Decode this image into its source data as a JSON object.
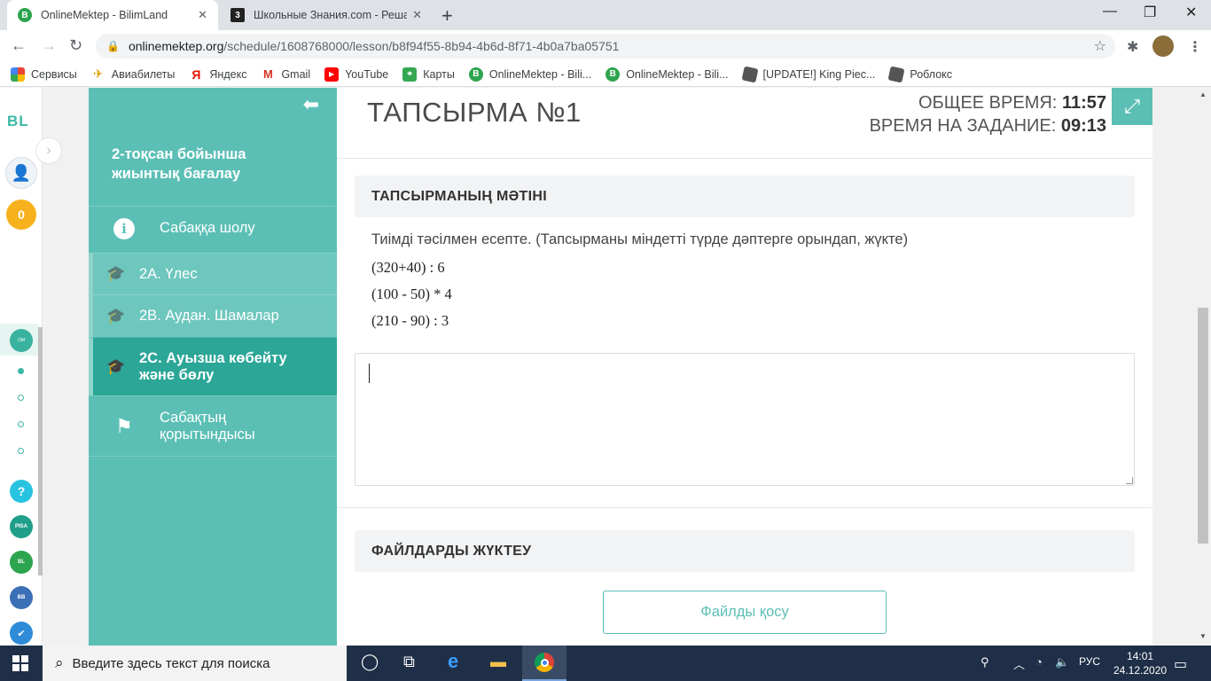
{
  "browser": {
    "tabs": [
      {
        "title": "OnlineMektep - BilimLand",
        "favicon": "onlinemektep-icon"
      },
      {
        "title": "Школьные Знания.com - Решае",
        "favicon": "znanija-icon"
      }
    ],
    "new_tab": "+",
    "url_host": "onlinemektep.org",
    "url_path": "/schedule/1608768000/lesson/b8f94f55-8b94-4b6d-8f71-4b0a7ba05751",
    "bookmarks": [
      {
        "label": "Сервисы",
        "icon": "apps-icon"
      },
      {
        "label": "Авиабилеты",
        "icon": "plane-icon"
      },
      {
        "label": "Яндекс",
        "icon": "yandex-icon"
      },
      {
        "label": "Gmail",
        "icon": "gmail-icon"
      },
      {
        "label": "YouTube",
        "icon": "youtube-icon"
      },
      {
        "label": "Карты",
        "icon": "maps-icon"
      },
      {
        "label": "OnlineMektep - Bili...",
        "icon": "onlinemektep-icon"
      },
      {
        "label": "OnlineMektep - Bili...",
        "icon": "onlinemektep-icon"
      },
      {
        "label": "[UPDATE!] King Piec...",
        "icon": "roblox-icon"
      },
      {
        "label": "Роблокс",
        "icon": "roblox-icon"
      }
    ]
  },
  "left_rail": {
    "logo": "BL",
    "coins": "0"
  },
  "course": {
    "heading": "2-тоқсан бойынша жиынтық бағалау",
    "items": [
      {
        "label": "Сабаққа шолу",
        "icon": "info-icon"
      },
      {
        "label": "2А. Үлес",
        "icon": "graduation-cap-icon"
      },
      {
        "label": "2В. Аудан. Шамалар",
        "icon": "graduation-cap-icon"
      },
      {
        "label": "2С. Ауызша көбейту және бөлу",
        "icon": "graduation-cap-icon"
      },
      {
        "label": "Сабақтың қорытындысы",
        "icon": "flag-icon"
      }
    ]
  },
  "task": {
    "title": "ТАПСЫРМА №1",
    "total_time_label": "ОБЩЕЕ ВРЕМЯ:",
    "total_time": "11:57",
    "task_time_label": "ВРЕМЯ НА ЗАДАНИЕ:",
    "task_time": "09:13",
    "text_section": "ТАПСЫРМАНЫҢ МӘТІНІ",
    "statement": "Тиімді тәсілмен есепте. (Тапсырманы міндетті түрде дәптерге орындап, жүкте)",
    "expressions": [
      "(320+40) : 6",
      "(100 - 50) * 4",
      "(210 - 90) : 3"
    ],
    "answer_value": "",
    "files_section": "ФАЙЛДАРДЫ ЖҮКТЕУ",
    "add_files": "Файлды қосу"
  },
  "taskbar": {
    "search_placeholder": "Введите здесь текст для поиска",
    "lang": "РУС",
    "time": "14:01",
    "date": "24.12.2020"
  },
  "colors": {
    "teal": "#5bbfb5",
    "teal_dark": "#2ba697"
  }
}
